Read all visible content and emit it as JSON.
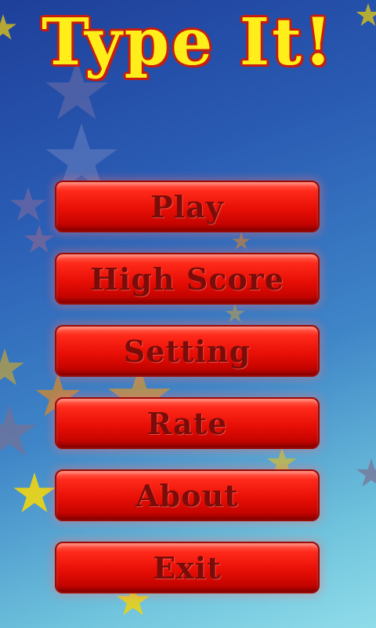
{
  "game": {
    "title": "Type It!"
  },
  "menu": {
    "play": "Play",
    "high_score": "High Score",
    "setting": "Setting",
    "rate": "Rate",
    "about": "About",
    "exit": "Exit"
  },
  "colors": {
    "title_fill": "#ffee1a",
    "title_outline": "#c41d12",
    "button_red": "#e80f06",
    "button_text": "#7a0d0a",
    "star_yellow": "#e8d21a",
    "star_orange": "#e08a20",
    "star_grey": "#7a6f92"
  }
}
